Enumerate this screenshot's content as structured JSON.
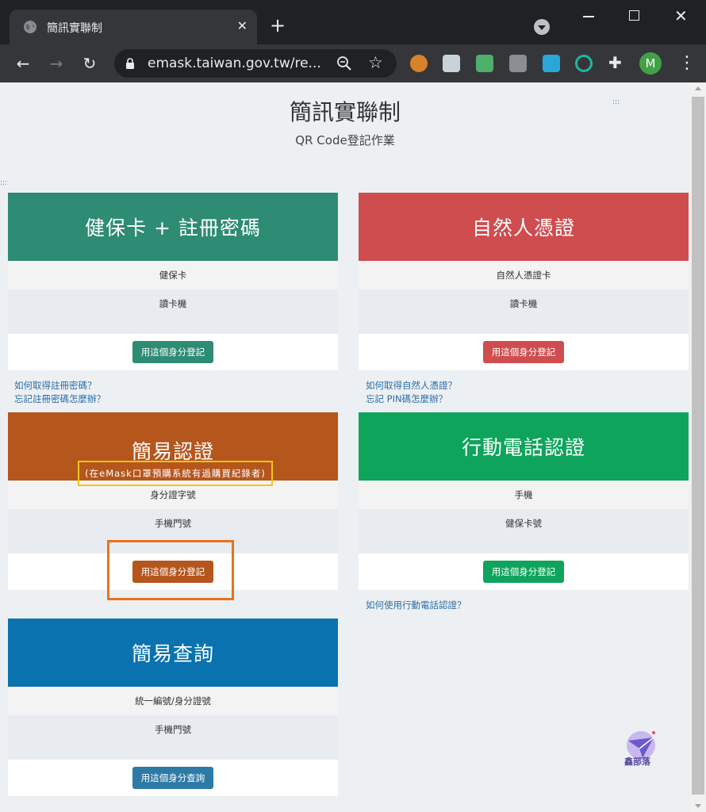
{
  "browser": {
    "tab_title": "簡訊實聯制",
    "tab_close": "✕",
    "new_tab": "+",
    "url": "emask.taiwan.gov.tw/re...",
    "profile_initial": "M",
    "icons": [
      "globe-icon",
      "search-tabs-icon",
      "minimize-icon",
      "maximize-icon",
      "close-window-icon",
      "back-icon",
      "forward-icon",
      "reload-icon",
      "lock-icon",
      "zoom-icon",
      "star-icon",
      "extension-icon",
      "menu-icon"
    ]
  },
  "page": {
    "title": "簡訊實聯制",
    "subtitle": "QR Code登記作業",
    "dots": ":::"
  },
  "cards": {
    "nhi": {
      "title": "健保卡 + 註冊密碼",
      "row1": "健保卡",
      "row2": "讀卡機",
      "button": "用這個身分登記",
      "links": [
        "如何取得註冊密碼？",
        "忘記註冊密碼怎麼辦？"
      ],
      "color": "#2e8b74"
    },
    "moica": {
      "title": "自然人憑證",
      "row1": "自然人憑證卡",
      "row2": "讀卡機",
      "button": "用這個身分登記",
      "links": [
        "如何取得自然人憑證？",
        "忘記 PIN碼怎麼辦？"
      ],
      "color": "#cf4d4f"
    },
    "simple": {
      "title": "簡易認證",
      "note": "(在eMask口罩預購系統有過購買紀錄者)",
      "row1": "身分證字號",
      "row2": "手機門號",
      "button": "用這個身分登記",
      "color": "#b5561d"
    },
    "mobile": {
      "title": "行動電話認證",
      "row1": "手機",
      "row2": "健保卡號",
      "button": "用這個身分登記",
      "links": [
        "如何使用行動電話認證？"
      ],
      "color": "#0ea45c"
    },
    "query": {
      "title": "簡易查詢",
      "row1": "統一編號/身分證號",
      "row2": "手機門號",
      "button": "用這個身分查詢",
      "color": "#0b72b0",
      "button_color": "#2e7aa6"
    }
  },
  "watermark": {
    "text": "鑫部落"
  }
}
